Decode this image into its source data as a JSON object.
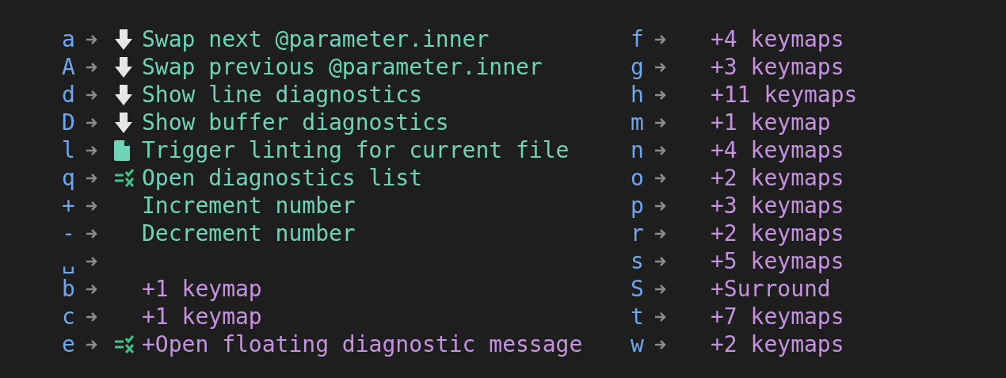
{
  "columns": [
    {
      "items": [
        {
          "key": "a",
          "kind": "down-action",
          "desc": "Swap next @parameter.inner"
        },
        {
          "key": "A",
          "kind": "down-action",
          "desc": "Swap previous @parameter.inner"
        },
        {
          "key": "d",
          "kind": "down-action",
          "desc": "Show line diagnostics"
        },
        {
          "key": "D",
          "kind": "down-action",
          "desc": "Show buffer diagnostics"
        },
        {
          "key": "l",
          "kind": "file-action",
          "desc": "Trigger linting for current file"
        },
        {
          "key": "q",
          "kind": "list-action",
          "desc": "Open diagnostics list"
        },
        {
          "key": "+",
          "kind": "action",
          "desc": "Increment number"
        },
        {
          "key": "-",
          "kind": "action",
          "desc": "Decrement number"
        },
        {
          "key": "␣",
          "kind": "action"
        },
        {
          "key": "b",
          "kind": "group",
          "desc": "+1 keymap"
        },
        {
          "key": "c",
          "kind": "group",
          "desc": "+1 keymap"
        },
        {
          "key": "e",
          "kind": "list-group",
          "desc": "+Open floating diagnostic message"
        }
      ]
    },
    {
      "items": [
        {
          "key": "f",
          "kind": "group",
          "desc": "+4 keymaps"
        },
        {
          "key": "g",
          "kind": "group",
          "desc": "+3 keymaps"
        },
        {
          "key": "h",
          "kind": "group",
          "desc": "+11 keymaps"
        },
        {
          "key": "m",
          "kind": "group",
          "desc": "+1 keymap"
        },
        {
          "key": "n",
          "kind": "group",
          "desc": "+4 keymaps"
        },
        {
          "key": "o",
          "kind": "group",
          "desc": "+2 keymaps"
        },
        {
          "key": "p",
          "kind": "group",
          "desc": "+3 keymaps"
        },
        {
          "key": "r",
          "kind": "group",
          "desc": "+2 keymaps"
        },
        {
          "key": "s",
          "kind": "group",
          "desc": "+5 keymaps"
        },
        {
          "key": "S",
          "kind": "group",
          "desc": "+Surround"
        },
        {
          "key": "t",
          "kind": "group",
          "desc": "+7 keymaps"
        },
        {
          "key": "w",
          "kind": "group",
          "desc": "+2 keymaps"
        }
      ]
    }
  ]
}
